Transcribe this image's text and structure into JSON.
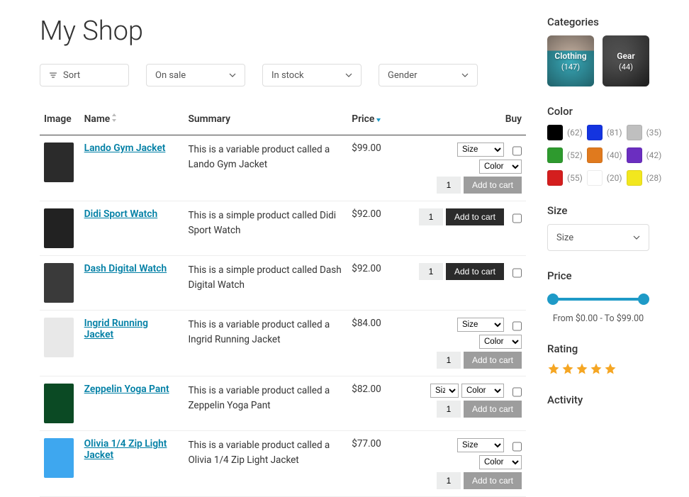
{
  "page": {
    "title": "My Shop"
  },
  "filters": {
    "sort_label": "Sort",
    "on_sale": "On sale",
    "in_stock": "In stock",
    "gender": "Gender"
  },
  "table": {
    "headers": {
      "image": "Image",
      "name": "Name",
      "summary": "Summary",
      "price": "Price",
      "buy": "Buy"
    },
    "option_labels": {
      "size": "Size",
      "color": "Color"
    },
    "qty_default": "1",
    "add_to_cart": "Add to cart",
    "rows": [
      {
        "name": "Lando Gym Jacket",
        "summary": "This is a variable product called a Lando Gym Jacket",
        "price": "$99.00",
        "variable": true,
        "size_wide": true,
        "inline_opts": false,
        "img": "#2b2b2b"
      },
      {
        "name": "Didi Sport Watch",
        "summary": "This is a simple product called Didi Sport Watch",
        "price": "$92.00",
        "variable": false,
        "img": "#222"
      },
      {
        "name": "Dash Digital Watch",
        "summary": "This is a simple product called Dash Digital Watch",
        "price": "$92.00",
        "variable": false,
        "img": "#3a3a3a"
      },
      {
        "name": "Ingrid Running Jacket",
        "summary": "This is a variable product called a Ingrid Running Jacket",
        "price": "$84.00",
        "variable": true,
        "size_wide": true,
        "inline_opts": false,
        "img": "#e8e8e8"
      },
      {
        "name": "Zeppelin Yoga Pant",
        "summary": "This is a variable product called a Zeppelin Yoga Pant",
        "price": "$82.00",
        "variable": true,
        "size_wide": false,
        "inline_opts": true,
        "img": "#0b4a24"
      },
      {
        "name": "Olivia 1/4 Zip Light Jacket",
        "summary": "This is a variable product called a Olivia 1/4 Zip Light Jacket",
        "price": "$77.00",
        "variable": true,
        "size_wide": true,
        "inline_opts": false,
        "img": "#3ea7ef"
      }
    ]
  },
  "sidebar": {
    "categories_h": "Categories",
    "categories": [
      {
        "name": "Clothing",
        "count": "(147)"
      },
      {
        "name": "Gear",
        "count": "(44)"
      }
    ],
    "color_h": "Color",
    "colors": [
      {
        "hex": "#000000",
        "count": "(62)"
      },
      {
        "hex": "#1434e0",
        "count": "(81)"
      },
      {
        "hex": "#bfbfbf",
        "count": "(35)"
      },
      {
        "hex": "#2e9a2e",
        "count": "(52)"
      },
      {
        "hex": "#e07a1e",
        "count": "(40)"
      },
      {
        "hex": "#6b2ec0",
        "count": "(42)"
      },
      {
        "hex": "#d41e1e",
        "count": "(55)"
      },
      {
        "hex": "#ffffff",
        "count": "(20)"
      },
      {
        "hex": "#f2e71e",
        "count": "(28)"
      }
    ],
    "size_h": "Size",
    "size_placeholder": "Size",
    "price_h": "Price",
    "price_range": "From $0.00 - To $99.00",
    "rating_h": "Rating",
    "activity_h": "Activity"
  }
}
